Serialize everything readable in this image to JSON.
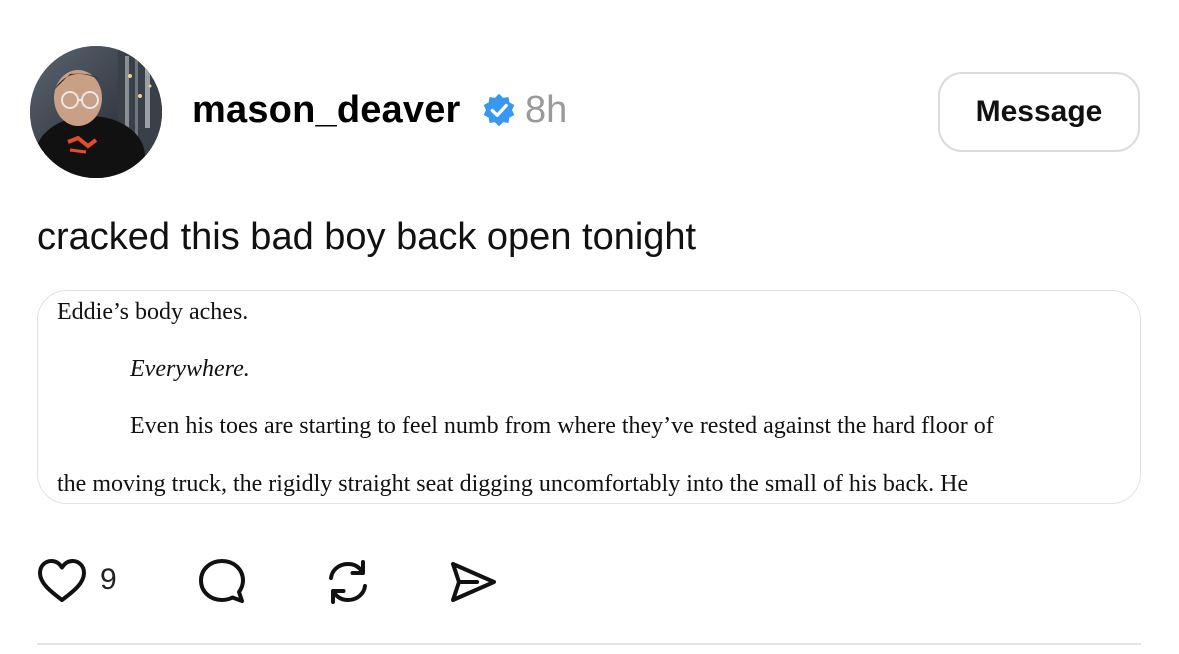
{
  "post": {
    "author": {
      "username": "mason_deaver",
      "verified": true,
      "avatar_icon": "profile-photo"
    },
    "timestamp": "8h",
    "message_button_label": "Message",
    "caption": "cracked this bad boy back open tonight",
    "attachment": {
      "lines": [
        "Eddie’s body aches.",
        "Everywhere.",
        "Even his toes are starting to feel numb from where they’ve rested against the hard floor of",
        "the moving truck, the rigidly straight seat digging uncomfortably into the small of his back. He"
      ]
    },
    "actions": {
      "like_icon": "heart-icon",
      "like_count": "9",
      "comment_icon": "comment-icon",
      "repost_icon": "repost-icon",
      "share_icon": "send-icon"
    }
  },
  "colors": {
    "verified_badge": "#3897f0",
    "timestamp": "#9a9a9a",
    "border": "#dcdcdc"
  }
}
